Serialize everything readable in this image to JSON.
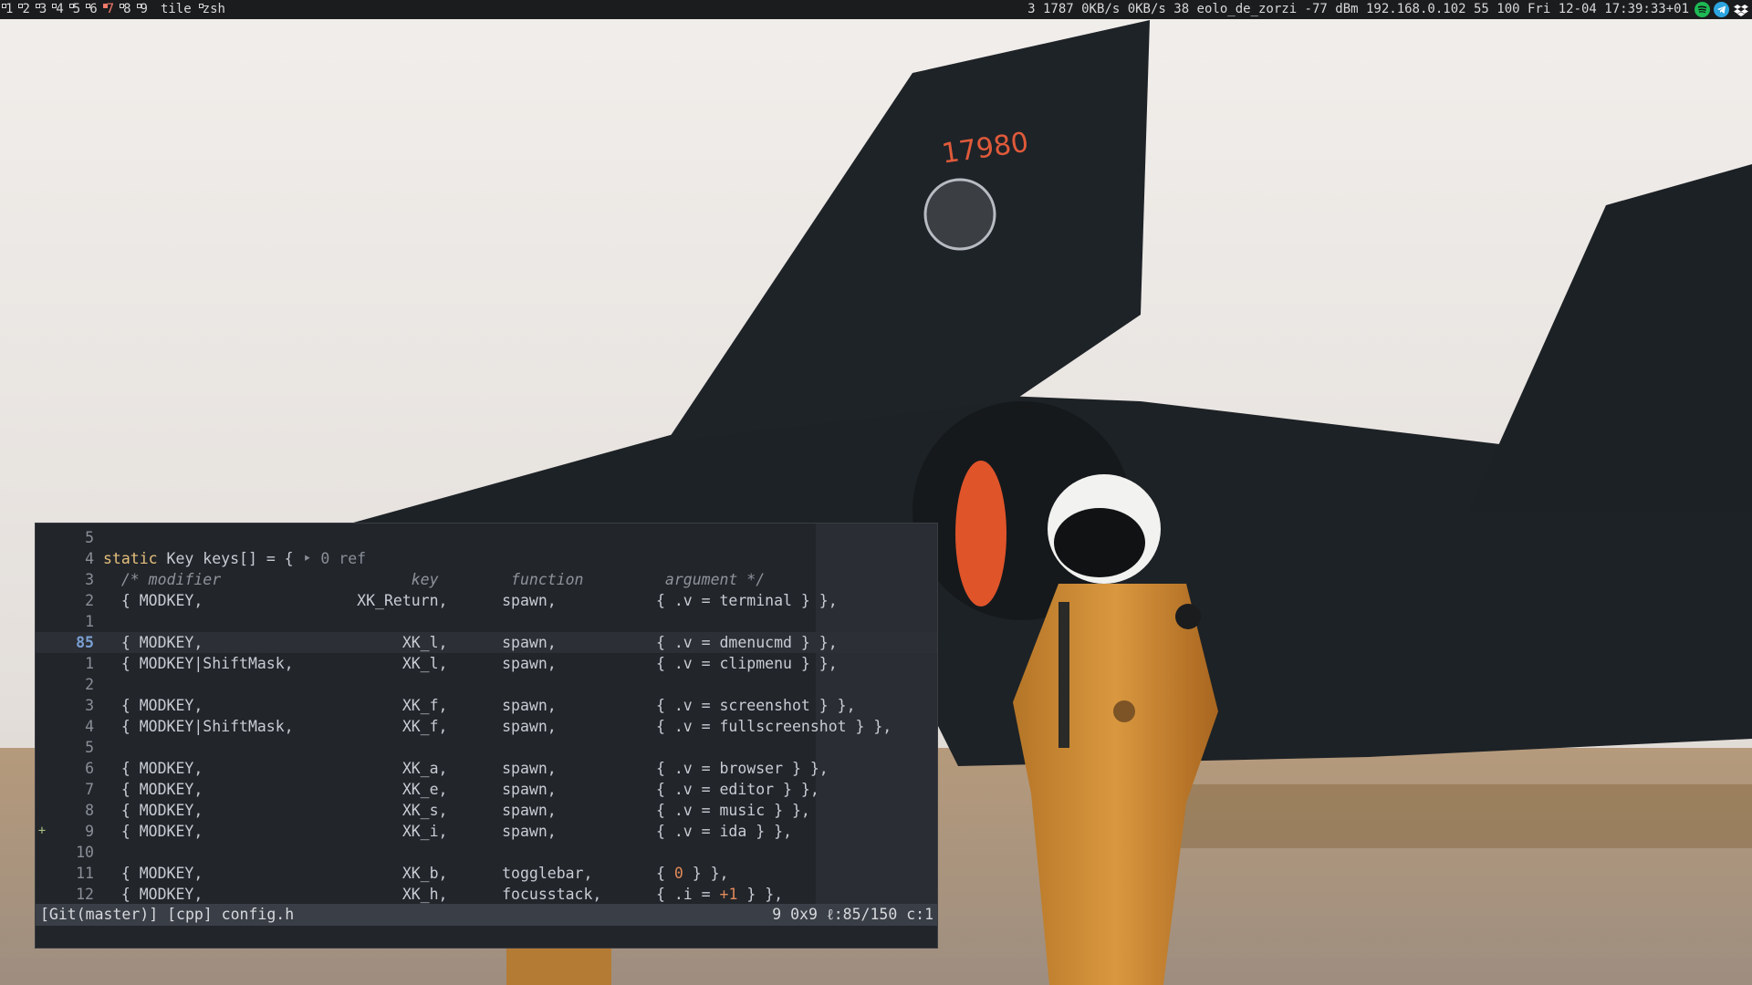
{
  "topbar": {
    "tags": [
      {
        "label": "1",
        "occupied": true,
        "active": false
      },
      {
        "label": "2",
        "occupied": true,
        "active": false
      },
      {
        "label": "3",
        "occupied": true,
        "active": false
      },
      {
        "label": "4",
        "occupied": true,
        "active": false
      },
      {
        "label": "5",
        "occupied": true,
        "active": false
      },
      {
        "label": "6",
        "occupied": true,
        "active": false
      },
      {
        "label": "7",
        "occupied": true,
        "active": true
      },
      {
        "label": "8",
        "occupied": true,
        "active": false
      },
      {
        "label": "9",
        "occupied": true,
        "active": false
      }
    ],
    "layout": "tile",
    "window_title": "zsh",
    "status": "3 1787 0KB/s 0KB/s 38 eolo_de_zorzi -77 dBm 192.168.0.102 55 100 Fri 12-04 17:39:33+01",
    "tray": [
      {
        "icon": "spotify-icon",
        "color": "#1db954"
      },
      {
        "icon": "telegram-icon",
        "color": "#2ca5e0"
      },
      {
        "icon": "dropbox-icon",
        "color": "#ffffff"
      }
    ]
  },
  "wallpaper": {
    "tail_number": "17980",
    "colors": {
      "sky": "#ebe7e4",
      "aircraft": "#1d2226",
      "suit": "#c98a3c",
      "exhaust": "#e0542a",
      "ground": "#b9a690"
    }
  },
  "editor": {
    "lines": [
      {
        "num": "5",
        "segments": []
      },
      {
        "num": "4",
        "segments": [
          {
            "t": "static",
            "c": "kw"
          },
          {
            "t": " Key keys[] = { ",
            "c": "txt"
          },
          {
            "t": "‣ 0 ref",
            "c": "vt"
          }
        ]
      },
      {
        "num": "3",
        "segments": [
          {
            "t": "  /* modifier                     key        function         argument */",
            "c": "cm"
          }
        ]
      },
      {
        "num": "2",
        "segments": [
          {
            "t": "  { MODKEY,                 XK_Return,      spawn,           { .v = terminal } },",
            "c": "txt"
          }
        ]
      },
      {
        "num": "1",
        "segments": []
      },
      {
        "num": "85",
        "current": true,
        "segments": [
          {
            "t": "  { MODKEY,                      XK_l,      spawn,           { .v = dmenucmd } },",
            "c": "txt"
          }
        ]
      },
      {
        "num": "1",
        "segments": [
          {
            "t": "  { MODKEY|ShiftMask,            XK_l,      spawn,           { .v = clipmenu } },",
            "c": "txt"
          }
        ]
      },
      {
        "num": "2",
        "segments": []
      },
      {
        "num": "3",
        "segments": [
          {
            "t": "  { MODKEY,                      XK_f,      spawn,           { .v = screenshot } },",
            "c": "txt"
          }
        ]
      },
      {
        "num": "4",
        "segments": [
          {
            "t": "  { MODKEY|ShiftMask,            XK_f,      spawn,           { .v = fullscreenshot } },",
            "c": "txt"
          }
        ]
      },
      {
        "num": "5",
        "segments": []
      },
      {
        "num": "6",
        "segments": [
          {
            "t": "  { MODKEY,                      XK_a,      spawn,           { .v = browser } },",
            "c": "txt"
          }
        ]
      },
      {
        "num": "7",
        "segments": [
          {
            "t": "  { MODKEY,                      XK_e,      spawn,           { .v = editor } },",
            "c": "txt"
          }
        ]
      },
      {
        "num": "8",
        "segments": [
          {
            "t": "  { MODKEY,                      XK_s,      spawn,           { .v = music } },",
            "c": "txt"
          }
        ]
      },
      {
        "num": "9",
        "sign": "+",
        "segments": [
          {
            "t": "  { MODKEY,                      XK_i,      spawn,           { .v = ida } },",
            "c": "txt"
          }
        ]
      },
      {
        "num": "10",
        "segments": []
      },
      {
        "num": "11",
        "segments": [
          {
            "t": "  { MODKEY,                      XK_b,      togglebar,       { ",
            "c": "txt"
          },
          {
            "t": "0",
            "c": "num"
          },
          {
            "t": " } },",
            "c": "txt"
          }
        ]
      },
      {
        "num": "12",
        "segments": [
          {
            "t": "  { MODKEY,                      XK_h,      focusstack,      { .i = ",
            "c": "txt"
          },
          {
            "t": "+1",
            "c": "num"
          },
          {
            "t": " } },",
            "c": "txt"
          }
        ]
      }
    ],
    "statusline": {
      "left": "[Git(master)] [cpp] config.h",
      "right": "9 0x9 ℓ:85/150 c:1"
    }
  }
}
